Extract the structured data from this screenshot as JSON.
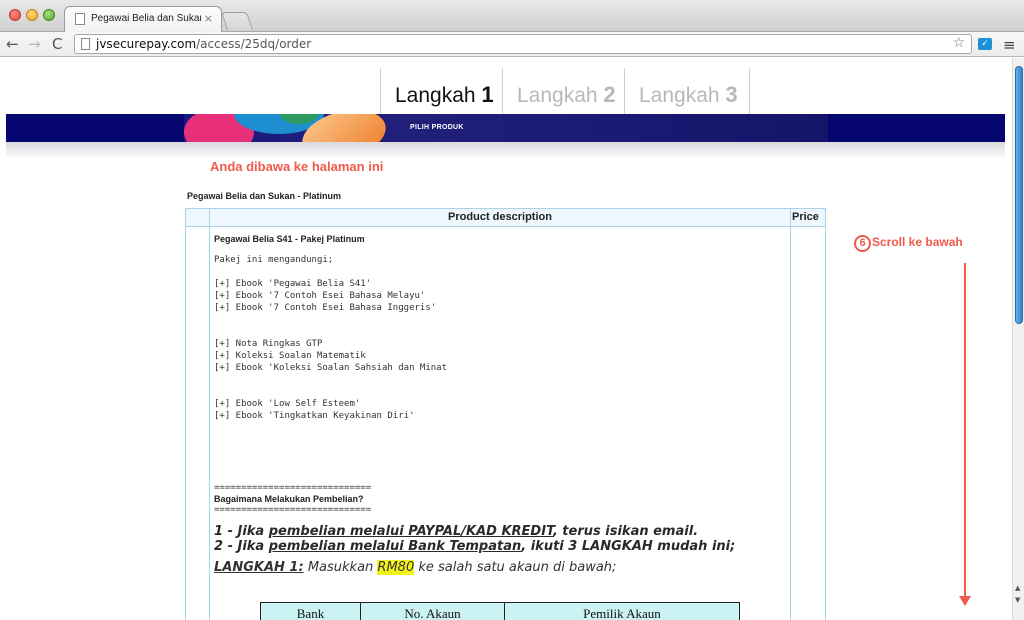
{
  "browser": {
    "tab_title": "Pegawai Belia dan Sukan -",
    "tab_close": "×",
    "url_host": "jvsecurepay.com",
    "url_path": "/access/25dq/order",
    "back": "←",
    "forward": "→",
    "reload": "C",
    "star": "☆",
    "menu": "≡"
  },
  "steps": [
    {
      "label": "Langkah",
      "number": "1"
    },
    {
      "label": "Langkah",
      "number": "2"
    },
    {
      "label": "Langkah",
      "number": "3"
    }
  ],
  "banner": {
    "label": "PILIH PRODUK"
  },
  "annotations": {
    "top": "Anda dibawa ke halaman ini",
    "step_number": "6",
    "step_text": "Scroll ke bawah"
  },
  "section_title": "Pegawai Belia dan Sukan - Platinum",
  "table": {
    "header_description": "Product description",
    "header_price": "Price"
  },
  "product": {
    "title": "Pegawai Belia S41 - Pakej Platinum",
    "intro": "Pakej ini mengandungi;",
    "group1": [
      "[+] Ebook 'Pegawai Belia S41'",
      "[+] Ebook '7 Contoh Esei Bahasa Melayu'",
      "[+] Ebook '7 Contoh Esei Bahasa Inggeris'"
    ],
    "group2": [
      "[+] Nota Ringkas GTP",
      "[+] Koleksi Soalan Matematik",
      "[+] Ebook 'Koleksi Soalan Sahsiah dan Minat"
    ],
    "group3": [
      "[+] Ebook 'Low Self Esteem'",
      "[+] Ebook 'Tingkatkan Keyakinan Diri'"
    ],
    "divider": "=============================",
    "howto": "Bagaimana Melakukan Pembelian?",
    "line1_pre": "1 - Jika ",
    "line1_link": "pembelian melalui PAYPAL/KAD KREDIT",
    "line1_post": ", terus isikan email.",
    "line2_pre": "2 - Jika ",
    "line2_link": "pembelian melalui Bank Tempatan",
    "line2_post": ", ikuti 3 LANGKAH mudah ini;",
    "langkah_label": "LANGKAH 1:",
    "langkah_pre": " Masukkan ",
    "langkah_amount": "RM80",
    "langkah_post": " ke salah satu akaun di bawah;"
  },
  "bank_table": {
    "headers": [
      "Bank",
      "No. Akaun",
      "Pemilik Akaun"
    ]
  }
}
